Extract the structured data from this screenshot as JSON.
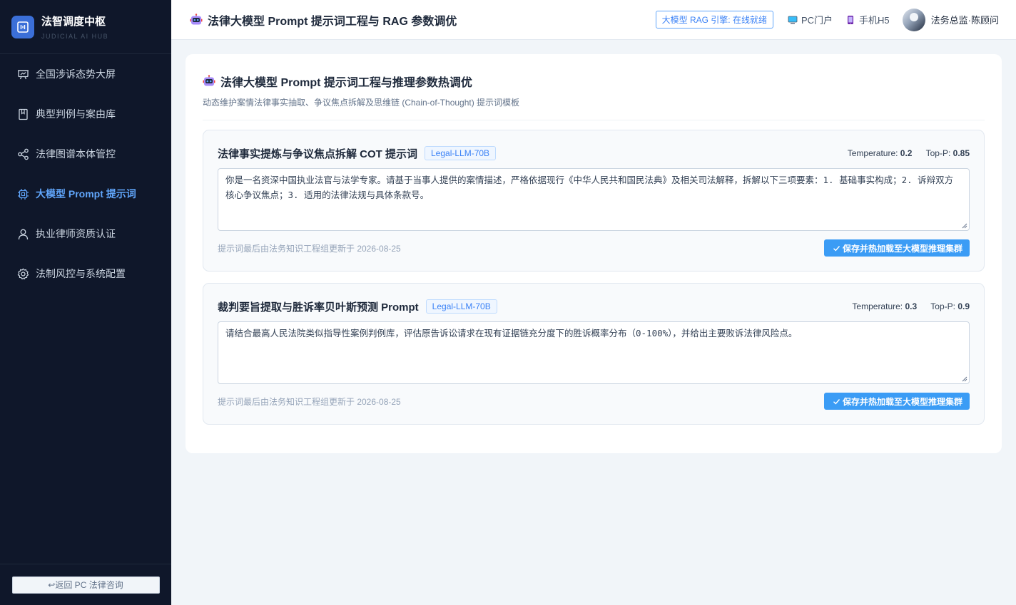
{
  "brand": {
    "title": "法智调度中枢",
    "subtitle": "JUDICIAL AI HUB"
  },
  "sidebar": {
    "items": [
      {
        "label": "全国涉诉态势大屏",
        "icon": "presentation-icon",
        "active": false
      },
      {
        "label": "典型判例与案由库",
        "icon": "book-icon",
        "active": false
      },
      {
        "label": "法律图谱本体管控",
        "icon": "share-icon",
        "active": false
      },
      {
        "label": "大模型 Prompt 提示词",
        "icon": "cpu-icon",
        "active": true
      },
      {
        "label": "执业律师资质认证",
        "icon": "user-icon",
        "active": false
      },
      {
        "label": "法制风控与系统配置",
        "icon": "gear-icon",
        "active": false
      }
    ],
    "back_label": "↩返回 PC 法律咨询"
  },
  "header": {
    "title": "法律大模型 Prompt 提示词工程与 RAG 参数调优",
    "engine_status": "大模型 RAG 引擎: 在线就绪",
    "pc_link": "PC门户",
    "mobile_link": "手机H5",
    "user_name": "法务总监·陈顾问"
  },
  "main": {
    "title": "法律大模型 Prompt 提示词工程与推理参数热调优",
    "subtitle": "动态维护案情法律事实抽取、争议焦点拆解及思维链 (Chain-of-Thought) 提示词模板"
  },
  "prompts": [
    {
      "title": "法律事实提炼与争议焦点拆解 COT 提示词",
      "model": "Legal-LLM-70B",
      "temperature_label": "Temperature:",
      "temperature": "0.2",
      "top_p_label": "Top-P:",
      "top_p": "0.85",
      "text": "你是一名资深中国执业法官与法学专家。请基于当事人提供的案情描述，严格依据现行《中华人民共和国民法典》及相关司法解释，拆解以下三项要素：1. 基础事实构成；2. 诉辩双方核心争议焦点；3. 适用的法律法规与具体条款号。",
      "updated": "提示词最后由法务知识工程组更新于 2026-08-25",
      "save_label": "保存并热加载至大模型推理集群"
    },
    {
      "title": "裁判要旨提取与胜诉率贝叶斯预测 Prompt",
      "model": "Legal-LLM-70B",
      "temperature_label": "Temperature:",
      "temperature": "0.3",
      "top_p_label": "Top-P:",
      "top_p": "0.9",
      "text": "请结合最高人民法院类似指导性案例判例库，评估原告诉讼请求在现有证据链充分度下的胜诉概率分布（0-100%），并给出主要败诉法律风险点。",
      "updated": "提示词最后由法务知识工程组更新于 2026-08-25",
      "save_label": "保存并热加载至大模型推理集群"
    }
  ],
  "colors": {
    "sidebar_bg": "#0f172a",
    "accent": "#3b82f6",
    "active_nav": "#60a5fa",
    "save_button": "#3b9cf5"
  }
}
